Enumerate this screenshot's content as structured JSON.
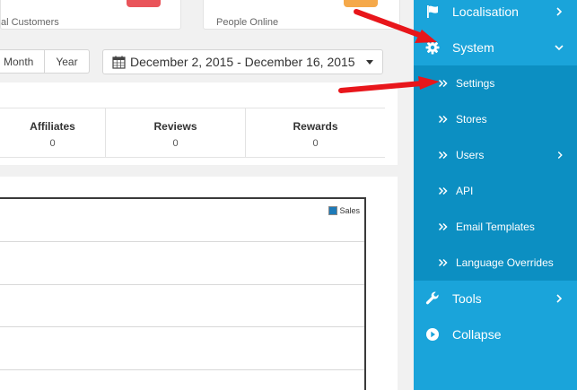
{
  "cards": {
    "left_label": "al Customers",
    "right_label": "People Online"
  },
  "range": {
    "month": "Month",
    "year": "Year"
  },
  "date_range": "December 2, 2015 - December 16, 2015",
  "stats": [
    {
      "label": "Affiliates",
      "value": "0"
    },
    {
      "label": "Reviews",
      "value": "0"
    },
    {
      "label": "Rewards",
      "value": "0"
    }
  ],
  "chart_legend": "Sales",
  "colors": {
    "sidebar": "#1aa4da",
    "submenu": "#0c8fc2",
    "legend_swatch": "#1e7ab8",
    "arrow": "#e8161b"
  },
  "sidebar": {
    "localisation": "Localisation",
    "system": "System",
    "tools": "Tools",
    "collapse": "Collapse",
    "submenu": [
      {
        "label": "Settings"
      },
      {
        "label": "Stores"
      },
      {
        "label": "Users"
      },
      {
        "label": "API"
      },
      {
        "label": "Email Templates"
      },
      {
        "label": "Language Overrides"
      }
    ]
  },
  "icons": {
    "localisation": "flag-icon",
    "system": "cog-icon",
    "tools": "wrench-icon",
    "collapse": "play-circle-icon",
    "calendar": "calendar-icon"
  }
}
